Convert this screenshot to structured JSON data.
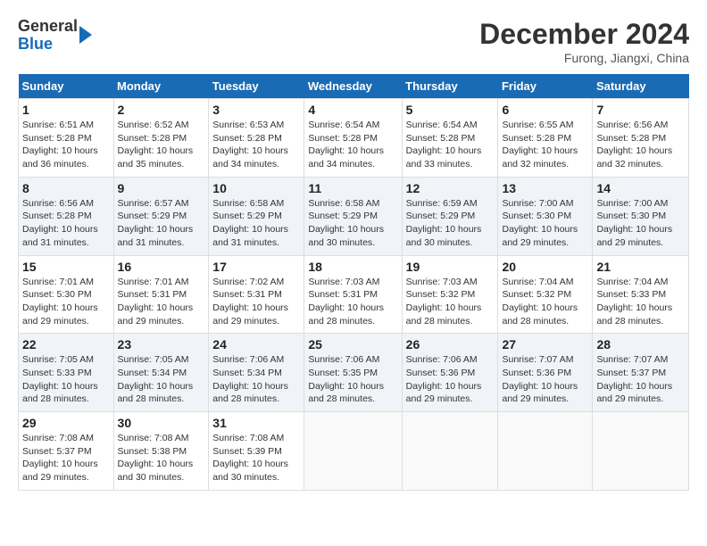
{
  "header": {
    "logo_line1": "General",
    "logo_line2": "Blue",
    "month": "December 2024",
    "location": "Furong, Jiangxi, China"
  },
  "weekdays": [
    "Sunday",
    "Monday",
    "Tuesday",
    "Wednesday",
    "Thursday",
    "Friday",
    "Saturday"
  ],
  "weeks": [
    [
      {
        "day": "1",
        "sunrise": "6:51 AM",
        "sunset": "5:28 PM",
        "daylight": "10 hours and 36 minutes."
      },
      {
        "day": "2",
        "sunrise": "6:52 AM",
        "sunset": "5:28 PM",
        "daylight": "10 hours and 35 minutes."
      },
      {
        "day": "3",
        "sunrise": "6:53 AM",
        "sunset": "5:28 PM",
        "daylight": "10 hours and 34 minutes."
      },
      {
        "day": "4",
        "sunrise": "6:54 AM",
        "sunset": "5:28 PM",
        "daylight": "10 hours and 34 minutes."
      },
      {
        "day": "5",
        "sunrise": "6:54 AM",
        "sunset": "5:28 PM",
        "daylight": "10 hours and 33 minutes."
      },
      {
        "day": "6",
        "sunrise": "6:55 AM",
        "sunset": "5:28 PM",
        "daylight": "10 hours and 32 minutes."
      },
      {
        "day": "7",
        "sunrise": "6:56 AM",
        "sunset": "5:28 PM",
        "daylight": "10 hours and 32 minutes."
      }
    ],
    [
      {
        "day": "8",
        "sunrise": "6:56 AM",
        "sunset": "5:28 PM",
        "daylight": "10 hours and 31 minutes."
      },
      {
        "day": "9",
        "sunrise": "6:57 AM",
        "sunset": "5:29 PM",
        "daylight": "10 hours and 31 minutes."
      },
      {
        "day": "10",
        "sunrise": "6:58 AM",
        "sunset": "5:29 PM",
        "daylight": "10 hours and 31 minutes."
      },
      {
        "day": "11",
        "sunrise": "6:58 AM",
        "sunset": "5:29 PM",
        "daylight": "10 hours and 30 minutes."
      },
      {
        "day": "12",
        "sunrise": "6:59 AM",
        "sunset": "5:29 PM",
        "daylight": "10 hours and 30 minutes."
      },
      {
        "day": "13",
        "sunrise": "7:00 AM",
        "sunset": "5:30 PM",
        "daylight": "10 hours and 29 minutes."
      },
      {
        "day": "14",
        "sunrise": "7:00 AM",
        "sunset": "5:30 PM",
        "daylight": "10 hours and 29 minutes."
      }
    ],
    [
      {
        "day": "15",
        "sunrise": "7:01 AM",
        "sunset": "5:30 PM",
        "daylight": "10 hours and 29 minutes."
      },
      {
        "day": "16",
        "sunrise": "7:01 AM",
        "sunset": "5:31 PM",
        "daylight": "10 hours and 29 minutes."
      },
      {
        "day": "17",
        "sunrise": "7:02 AM",
        "sunset": "5:31 PM",
        "daylight": "10 hours and 29 minutes."
      },
      {
        "day": "18",
        "sunrise": "7:03 AM",
        "sunset": "5:31 PM",
        "daylight": "10 hours and 28 minutes."
      },
      {
        "day": "19",
        "sunrise": "7:03 AM",
        "sunset": "5:32 PM",
        "daylight": "10 hours and 28 minutes."
      },
      {
        "day": "20",
        "sunrise": "7:04 AM",
        "sunset": "5:32 PM",
        "daylight": "10 hours and 28 minutes."
      },
      {
        "day": "21",
        "sunrise": "7:04 AM",
        "sunset": "5:33 PM",
        "daylight": "10 hours and 28 minutes."
      }
    ],
    [
      {
        "day": "22",
        "sunrise": "7:05 AM",
        "sunset": "5:33 PM",
        "daylight": "10 hours and 28 minutes."
      },
      {
        "day": "23",
        "sunrise": "7:05 AM",
        "sunset": "5:34 PM",
        "daylight": "10 hours and 28 minutes."
      },
      {
        "day": "24",
        "sunrise": "7:06 AM",
        "sunset": "5:34 PM",
        "daylight": "10 hours and 28 minutes."
      },
      {
        "day": "25",
        "sunrise": "7:06 AM",
        "sunset": "5:35 PM",
        "daylight": "10 hours and 28 minutes."
      },
      {
        "day": "26",
        "sunrise": "7:06 AM",
        "sunset": "5:36 PM",
        "daylight": "10 hours and 29 minutes."
      },
      {
        "day": "27",
        "sunrise": "7:07 AM",
        "sunset": "5:36 PM",
        "daylight": "10 hours and 29 minutes."
      },
      {
        "day": "28",
        "sunrise": "7:07 AM",
        "sunset": "5:37 PM",
        "daylight": "10 hours and 29 minutes."
      }
    ],
    [
      {
        "day": "29",
        "sunrise": "7:08 AM",
        "sunset": "5:37 PM",
        "daylight": "10 hours and 29 minutes."
      },
      {
        "day": "30",
        "sunrise": "7:08 AM",
        "sunset": "5:38 PM",
        "daylight": "10 hours and 30 minutes."
      },
      {
        "day": "31",
        "sunrise": "7:08 AM",
        "sunset": "5:39 PM",
        "daylight": "10 hours and 30 minutes."
      },
      null,
      null,
      null,
      null
    ]
  ]
}
